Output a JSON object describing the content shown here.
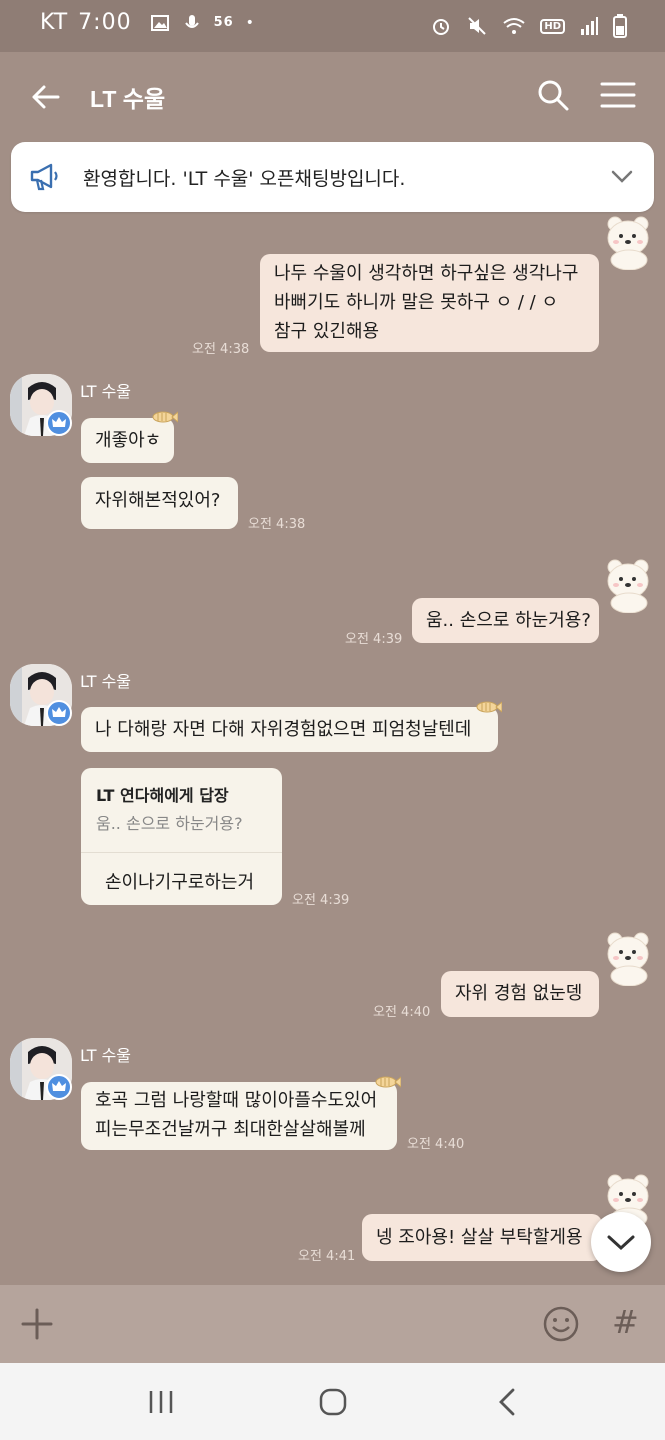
{
  "status_bar": {
    "carrier": "KT",
    "time": "7:00",
    "network": "56",
    "hd_label": "HD"
  },
  "header": {
    "title": "LT 수울"
  },
  "notice": {
    "text": "환영합니다. 'LT 수울' 오픈채팅방입니다."
  },
  "messages": {
    "m1": {
      "line1": "나두 수울이 생각하면 하구싶은 생각나구",
      "line2": "바뻐기도 하니까 말은 못하구 ㅇ / / ㅇ",
      "line3": "참구 있긴해용",
      "time": "오전 4:38"
    },
    "m2": {
      "sender": "LT 수울",
      "bubble1": "개좋아ㅎ",
      "bubble2": "자위해본적있어?",
      "time": "오전 4:38"
    },
    "m3": {
      "text": "움.. 손으로 하눈거용?",
      "time": "오전 4:39"
    },
    "m4": {
      "sender": "LT 수울",
      "bubble1": "나 다해랑 자면 다해 자위경험없으면 피엄청날텐데",
      "reply_name": "LT 연다해에게 답장",
      "reply_quote": "움.. 손으로 하눈거용?",
      "reply_body": "손이나기구로하는거",
      "time": "오전 4:39"
    },
    "m5": {
      "text": "자위 경험 없눈뎅",
      "time": "오전 4:40"
    },
    "m6": {
      "sender": "LT 수울",
      "line1": "호곡 그럼 나랑할때 많이아플수도있어",
      "line2": "피는무조건날꺼구 최대한살살해볼께",
      "time": "오전 4:40"
    },
    "m7": {
      "text": "넹 조아용! 살살 부탁할게용",
      "time": "오전 4:41"
    }
  },
  "input_bar": {
    "hash_label": "#"
  },
  "colors": {
    "chat_bg": "#a28f86",
    "my_bubble": "#f6e6dc",
    "their_bubble": "#f7f3ea",
    "crown_badge": "#4f8fe0"
  }
}
